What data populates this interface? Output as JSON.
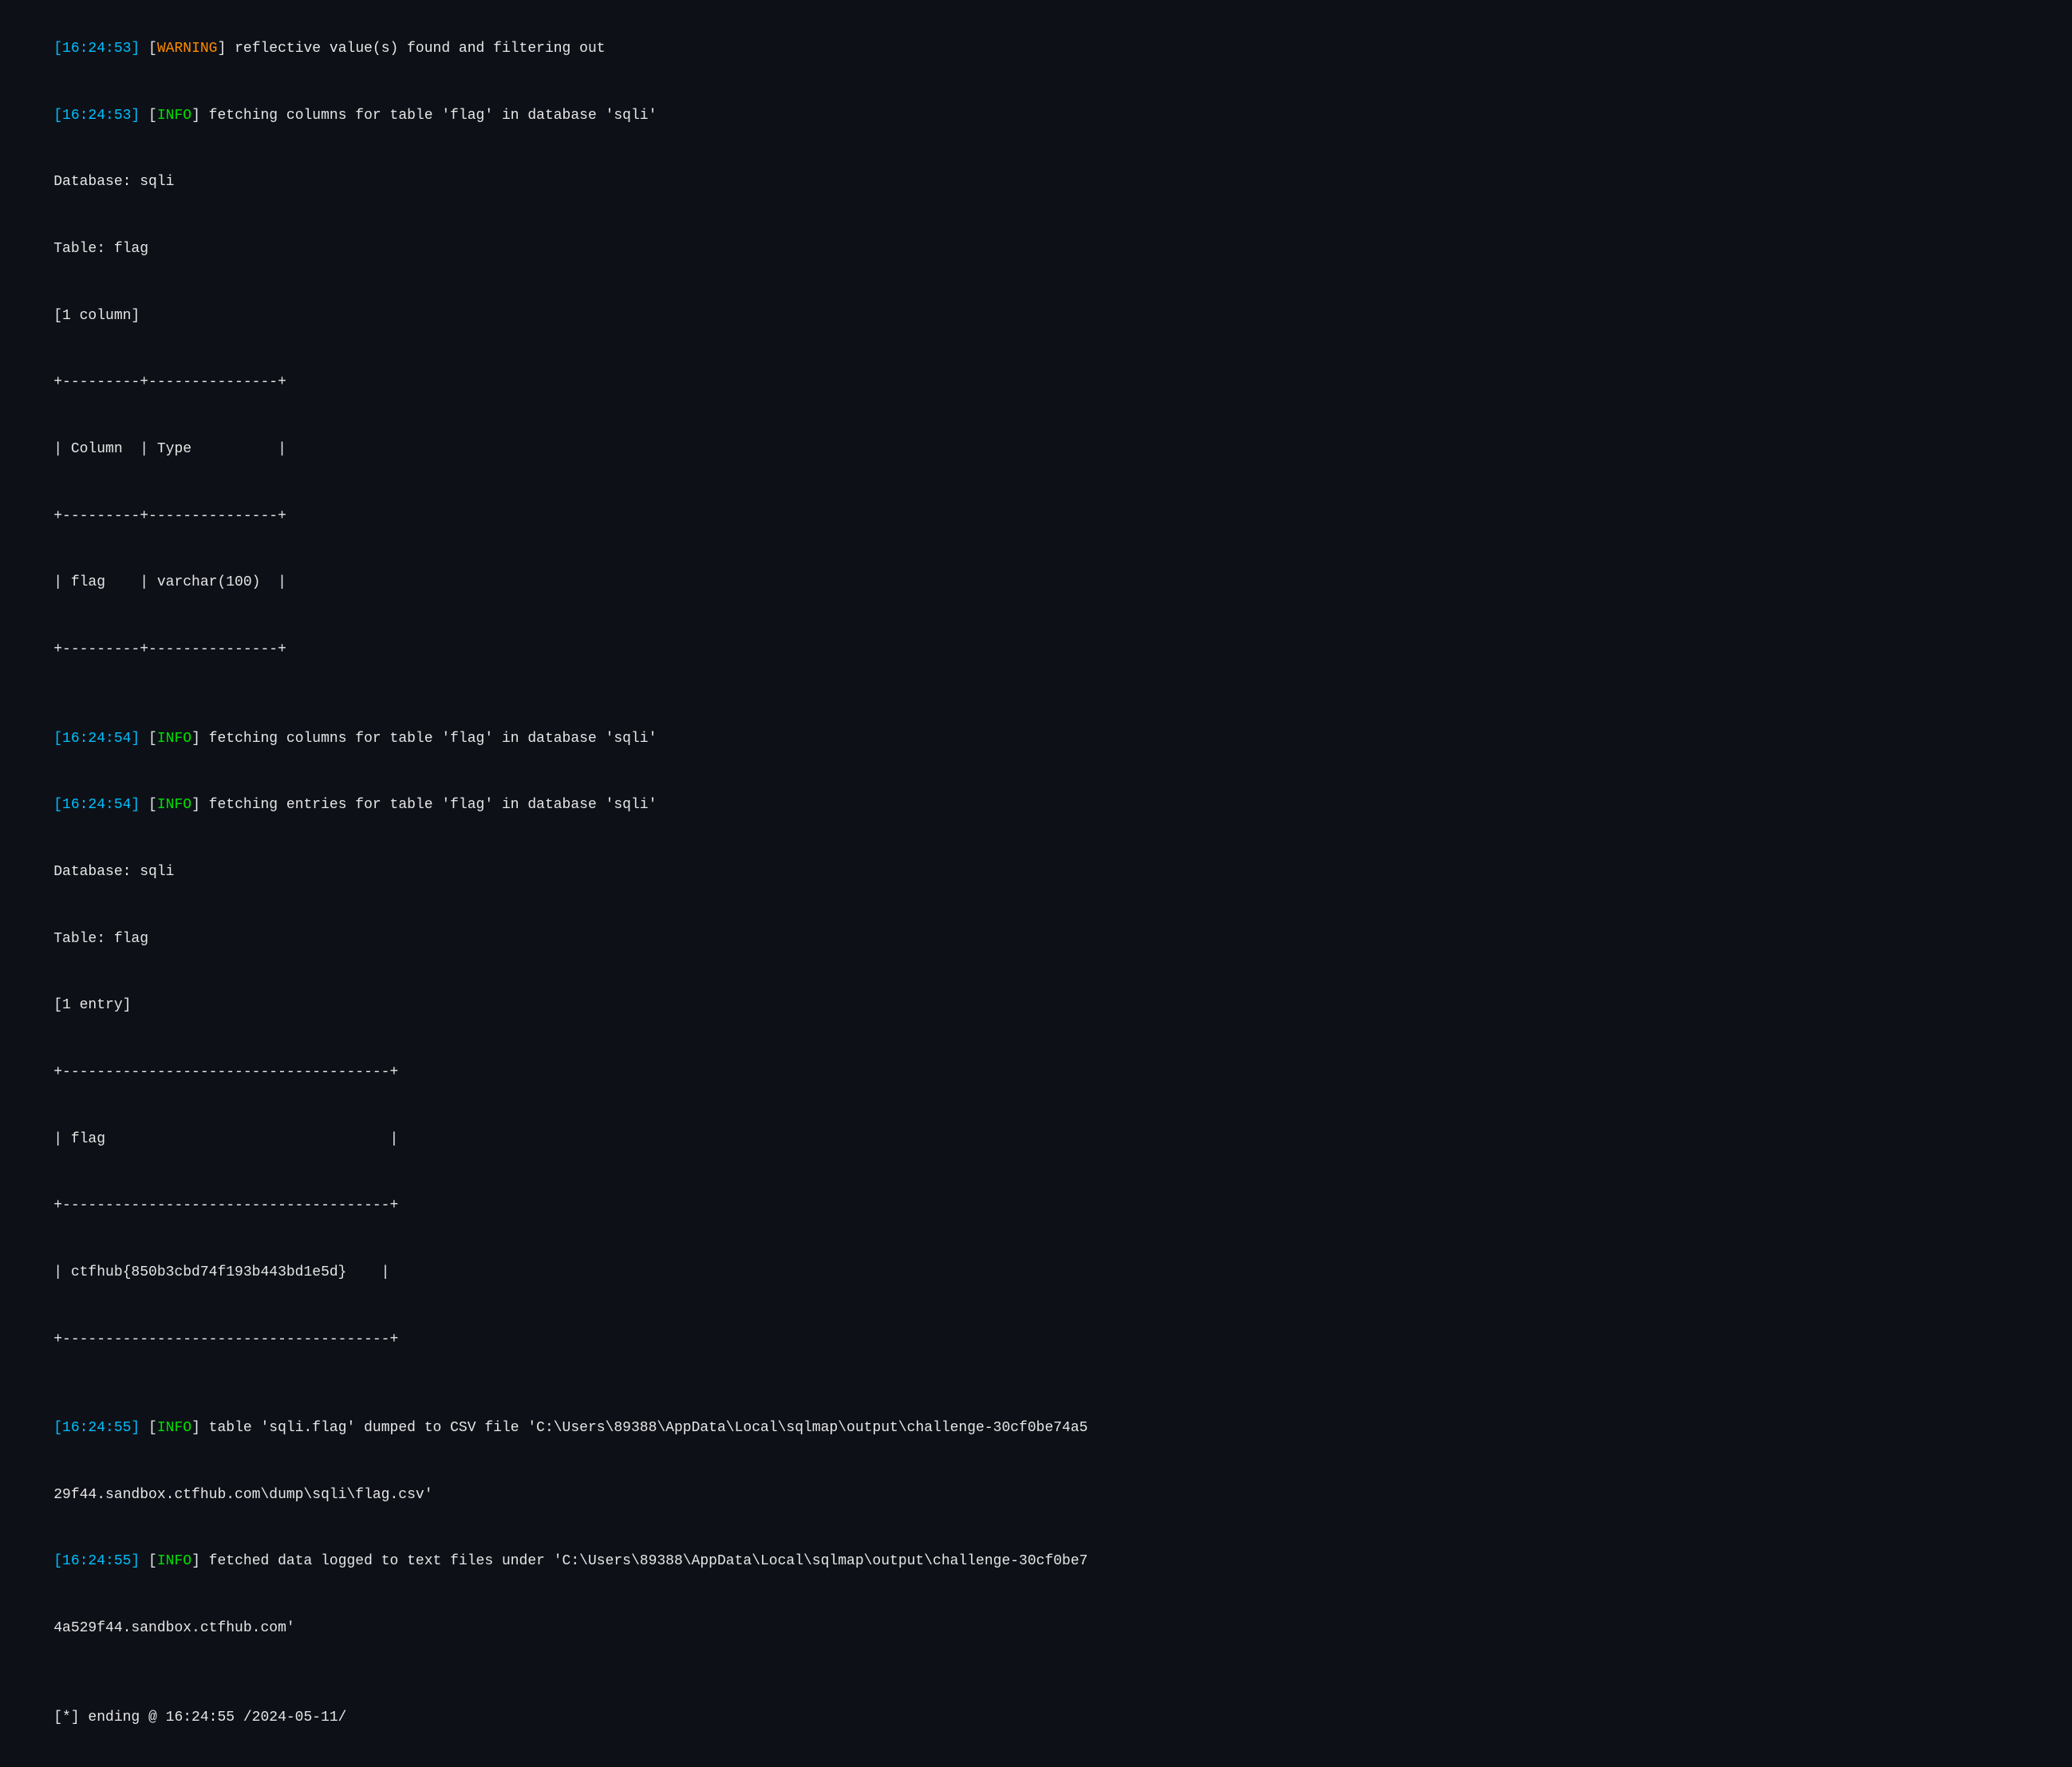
{
  "terminal": {
    "lines": [
      {
        "id": "line1",
        "parts": [
          {
            "type": "timestamp",
            "text": "[16:24:53]"
          },
          {
            "type": "plain",
            "text": " ["
          },
          {
            "type": "warning",
            "text": "WARNING"
          },
          {
            "type": "plain",
            "text": "] reflective value(s) found and filtering out"
          }
        ]
      },
      {
        "id": "line2",
        "parts": [
          {
            "type": "timestamp",
            "text": "[16:24:53]"
          },
          {
            "type": "plain",
            "text": " ["
          },
          {
            "type": "info",
            "text": "INFO"
          },
          {
            "type": "plain",
            "text": "] fetching columns for table 'flag' in database 'sqli'"
          }
        ]
      },
      {
        "id": "line3",
        "parts": [
          {
            "type": "plain",
            "text": "Database: sqli"
          }
        ]
      },
      {
        "id": "line4",
        "parts": [
          {
            "type": "plain",
            "text": "Table: flag"
          }
        ]
      },
      {
        "id": "line5",
        "parts": [
          {
            "type": "plain",
            "text": "[1 column]"
          }
        ]
      },
      {
        "id": "line6",
        "parts": [
          {
            "type": "plain",
            "text": "+---------+---------------+"
          }
        ]
      },
      {
        "id": "line7",
        "parts": [
          {
            "type": "plain",
            "text": "| Column  | Type          |"
          }
        ]
      },
      {
        "id": "line8",
        "parts": [
          {
            "type": "plain",
            "text": "+---------+---------------+"
          }
        ]
      },
      {
        "id": "line9",
        "parts": [
          {
            "type": "plain",
            "text": "| flag    | varchar(100)  |"
          }
        ]
      },
      {
        "id": "line10",
        "parts": [
          {
            "type": "plain",
            "text": "+---------+---------------+"
          }
        ]
      },
      {
        "id": "spacer1",
        "parts": [
          {
            "type": "plain",
            "text": ""
          }
        ]
      },
      {
        "id": "line11",
        "parts": [
          {
            "type": "timestamp",
            "text": "[16:24:54]"
          },
          {
            "type": "plain",
            "text": " ["
          },
          {
            "type": "info",
            "text": "INFO"
          },
          {
            "type": "plain",
            "text": "] fetching columns for table 'flag' in database 'sqli'"
          }
        ]
      },
      {
        "id": "line12",
        "parts": [
          {
            "type": "timestamp",
            "text": "[16:24:54]"
          },
          {
            "type": "plain",
            "text": " ["
          },
          {
            "type": "info",
            "text": "INFO"
          },
          {
            "type": "plain",
            "text": "] fetching entries for table 'flag' in database 'sqli'"
          }
        ]
      },
      {
        "id": "line13",
        "parts": [
          {
            "type": "plain",
            "text": "Database: sqli"
          }
        ]
      },
      {
        "id": "line14",
        "parts": [
          {
            "type": "plain",
            "text": "Table: flag"
          }
        ]
      },
      {
        "id": "line15",
        "parts": [
          {
            "type": "plain",
            "text": "[1 entry]"
          }
        ]
      },
      {
        "id": "line16",
        "parts": [
          {
            "type": "plain",
            "text": "+--------------------------------------+"
          }
        ]
      },
      {
        "id": "line17",
        "parts": [
          {
            "type": "plain",
            "text": "| flag                                 |"
          }
        ]
      },
      {
        "id": "line18",
        "parts": [
          {
            "type": "plain",
            "text": "+--------------------------------------+"
          }
        ]
      },
      {
        "id": "line19",
        "parts": [
          {
            "type": "plain",
            "text": "| ctfhub{850b3cbd74f193b443bd1e5d}    |"
          }
        ]
      },
      {
        "id": "line20",
        "parts": [
          {
            "type": "plain",
            "text": "+--------------------------------------+"
          }
        ]
      },
      {
        "id": "spacer2",
        "parts": [
          {
            "type": "plain",
            "text": ""
          }
        ]
      },
      {
        "id": "line21",
        "parts": [
          {
            "type": "timestamp",
            "text": "[16:24:55]"
          },
          {
            "type": "plain",
            "text": " ["
          },
          {
            "type": "info",
            "text": "INFO"
          },
          {
            "type": "plain",
            "text": "] table 'sqli.flag' dumped to CSV file 'C:\\Users\\89388\\AppData\\Local\\sqlmap\\output\\challenge-30cf0be74a529f44.sandbox.ctfhub.com\\dump\\sqli\\flag.csv'"
          }
        ]
      },
      {
        "id": "line22",
        "parts": [
          {
            "type": "timestamp",
            "text": "[16:24:55]"
          },
          {
            "type": "plain",
            "text": " ["
          },
          {
            "type": "info",
            "text": "INFO"
          },
          {
            "type": "plain",
            "text": "] fetched data logged to text files under 'C:\\Users\\89388\\AppData\\Local\\sqlmap\\output\\challenge-30cf0be74a529f44.sandbox.ctfhub.com'"
          }
        ]
      },
      {
        "id": "spacer3",
        "parts": [
          {
            "type": "plain",
            "text": ""
          }
        ]
      },
      {
        "id": "line23",
        "parts": [
          {
            "type": "plain",
            "text": "[*] ending @ 16:24:55 /2024-05-11/"
          }
        ]
      }
    ]
  }
}
